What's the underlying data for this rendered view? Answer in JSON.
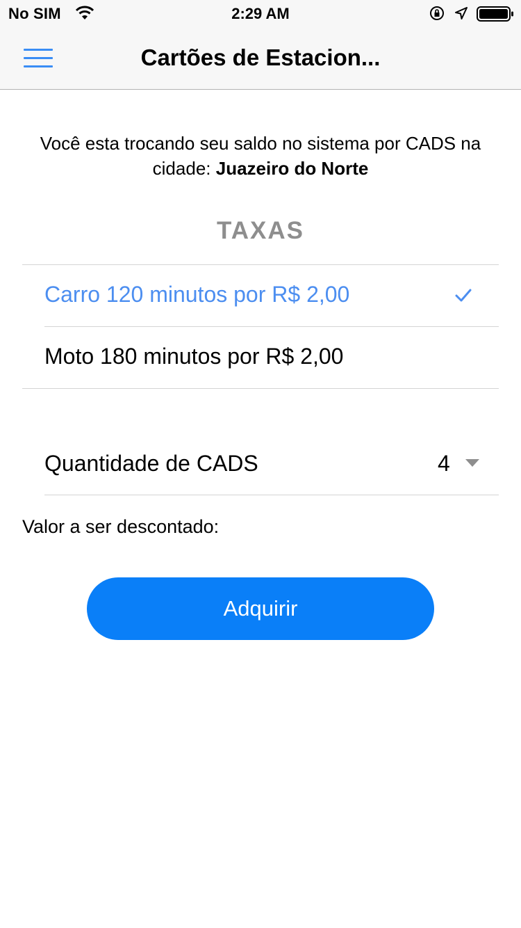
{
  "status_bar": {
    "carrier": "No SIM",
    "time": "2:29 AM",
    "icons": [
      "wifi-icon",
      "orientation-lock-icon",
      "location-icon",
      "battery-icon"
    ]
  },
  "nav": {
    "title": "Cartões de Estacion...",
    "menu_icon": "hamburger-menu-icon"
  },
  "intro": {
    "text": "Você esta trocando seu saldo no sistema por CADS na cidade: ",
    "city": "Juazeiro do Norte"
  },
  "rates": {
    "title": "TAXAS",
    "items": [
      {
        "label": "Carro 120 minutos por R$ 2,00",
        "selected": true
      },
      {
        "label": "Moto 180 minutos por R$ 2,00",
        "selected": false
      }
    ]
  },
  "quantity": {
    "label": "Quantidade de CADS",
    "value": "4"
  },
  "deduction": {
    "label": "Valor a ser descontado:"
  },
  "buy_button": {
    "label": "Adquirir"
  },
  "colors": {
    "accent": "#4c8ef0",
    "button": "#0a7ff8",
    "section_title": "#8e8e8e"
  }
}
